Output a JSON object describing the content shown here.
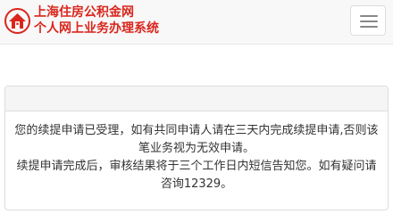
{
  "header": {
    "title_line1": "上海住房公积金网",
    "title_line2": "个人网上业务办理系统",
    "logo_icon": "house-logo-icon",
    "menu_icon": "hamburger-menu-icon",
    "brand_color": "#d9261c"
  },
  "notice": {
    "line1": "您的续提申请已受理，如有共同申请人请在三天内完成续提申请,否则该笔业务视为无效申请。",
    "line2": "续提申请完成后，审核结果将于三个工作日内短信告知您。如有疑问请咨询12329。"
  }
}
